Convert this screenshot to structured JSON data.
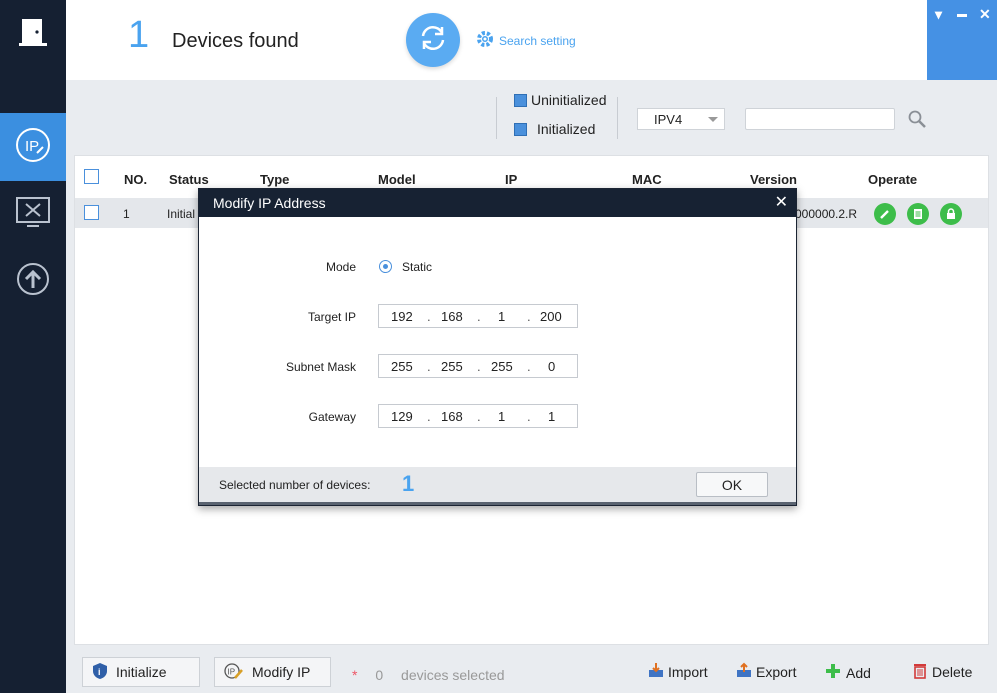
{
  "header": {
    "device_count": "1",
    "devices_found_label": "Devices found",
    "search_setting_label": "Search setting"
  },
  "window_controls": {
    "menu": "▾",
    "minimize": "▬",
    "close": "✕"
  },
  "filters": {
    "uninitialized_label": "Uninitialized",
    "initialized_label": "Initialized",
    "ip_version_value": "IPV4",
    "search_value": ""
  },
  "table": {
    "headers": [
      "NO.",
      "Status",
      "Type",
      "Model",
      "IP",
      "MAC",
      "Version",
      "Operate"
    ],
    "rows": [
      {
        "no": "1",
        "status": "Initial",
        "version": "000000.2.R"
      }
    ]
  },
  "dialog": {
    "title": "Modify IP Address",
    "mode_label": "Mode",
    "mode_value": "Static",
    "target_ip_label": "Target IP",
    "target_ip": [
      "192",
      "168",
      "1",
      "200"
    ],
    "subnet_mask_label": "Subnet Mask",
    "subnet_mask": [
      "255",
      "255",
      "255",
      "0"
    ],
    "gateway_label": "Gateway",
    "gateway": [
      "129",
      "168",
      "1",
      "1"
    ],
    "selected_label": "Selected number of devices:",
    "selected_count": "1",
    "ok_label": "OK"
  },
  "bottom": {
    "initialize_label": "Initialize",
    "modify_ip_label": "Modify IP",
    "star": "*",
    "selected_count": "0",
    "selected_text": "devices selected",
    "import_label": "Import",
    "export_label": "Export",
    "add_label": "Add",
    "delete_label": "Delete"
  },
  "colors": {
    "nav_bg": "#152032",
    "accent": "#4aa3ef",
    "active_nav": "#3b8fe0",
    "op_green": "#3dbd4a",
    "dialog_header": "#172233"
  }
}
